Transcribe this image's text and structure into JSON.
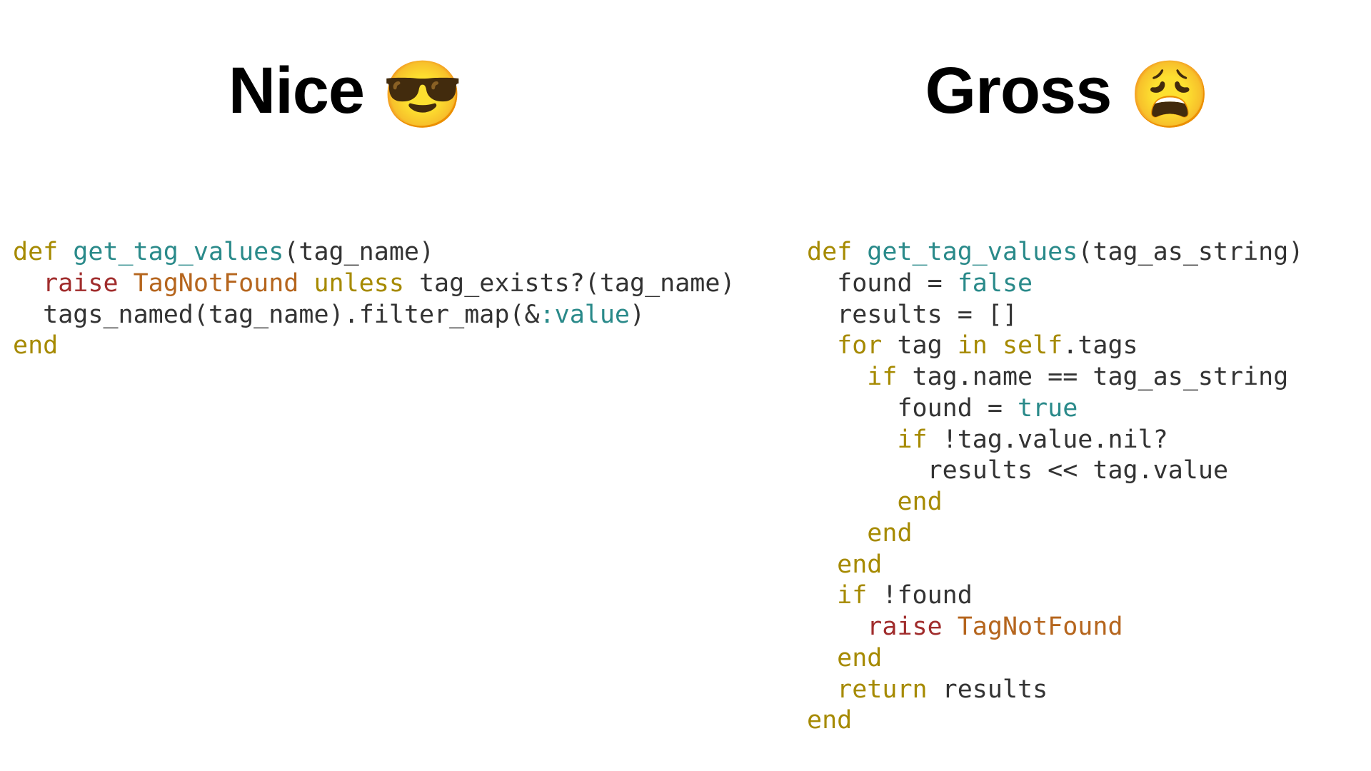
{
  "left": {
    "title": "Nice ",
    "emoji": "😎",
    "code": {
      "l1": {
        "def": "def",
        "fn": "get_tag_values",
        "open": "(",
        "param": "tag_name",
        "close": ")"
      },
      "l2": {
        "raise": "raise",
        "cls": "TagNotFound",
        "unless": "unless",
        "call": "tag_exists?",
        "open": "(",
        "param": "tag_name",
        "close": ")"
      },
      "l3": {
        "call1": "tags_named",
        "open": "(",
        "param": "tag_name",
        "close": ")",
        "dot": ".",
        "call2": "filter_map",
        "open2": "(&",
        "sym": ":value",
        "close2": ")"
      },
      "l4": {
        "end": "end"
      }
    }
  },
  "right": {
    "title": "Gross ",
    "emoji": "😩",
    "code": {
      "l1": {
        "def": "def",
        "fn": "get_tag_values",
        "open": "(",
        "param": "tag_as_string",
        "close": ")"
      },
      "l2": {
        "var": "found = ",
        "val": "false"
      },
      "l3": {
        "text": "results = []"
      },
      "l4": {
        "for": "for",
        "sp1": " tag ",
        "in": "in",
        "sp2": " ",
        "self": "self",
        "rest": ".tags"
      },
      "l5": {
        "if": "if",
        "rest": " tag.name == tag_as_string"
      },
      "l6": {
        "var": "found = ",
        "val": "true"
      },
      "l7": {
        "if": "if",
        "rest": " !tag.value.nil?"
      },
      "l8": {
        "text": "results << tag.value"
      },
      "l9": {
        "end": "end"
      },
      "l10": {
        "end": "end"
      },
      "l11": {
        "end": "end"
      },
      "l12": {
        "if": "if",
        "rest": " !found"
      },
      "l13": {
        "raise": "raise",
        "sp": " ",
        "cls": "TagNotFound"
      },
      "l14": {
        "end": "end"
      },
      "l15": {
        "return": "return",
        "rest": " results"
      },
      "l16": {
        "end": "end"
      }
    }
  }
}
